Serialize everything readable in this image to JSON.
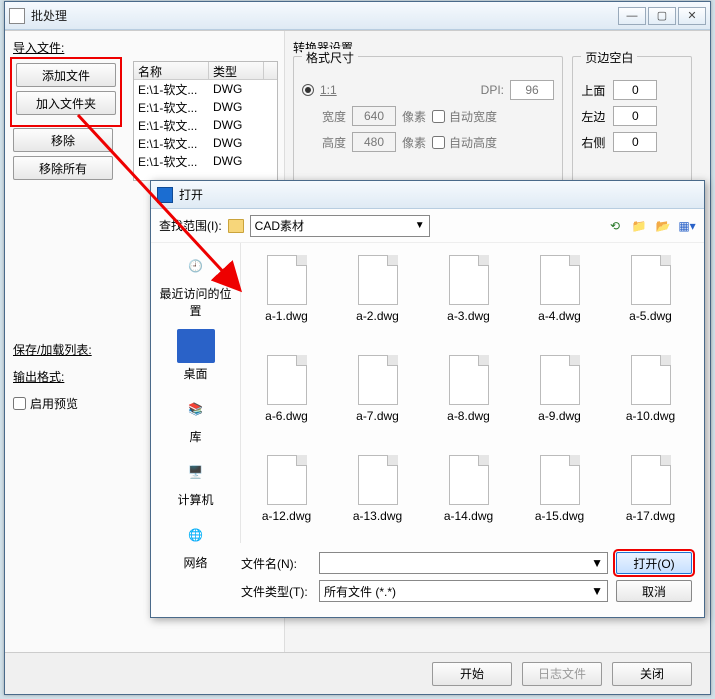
{
  "main_window": {
    "title": "批处理",
    "import_label": "导入文件:",
    "buttons": {
      "add_file": "添加文件",
      "add_folder": "加入文件夹",
      "remove": "移除",
      "remove_all": "移除所有"
    },
    "file_list": {
      "cols": {
        "name": "名称",
        "type": "类型"
      },
      "rows": [
        {
          "name": "E:\\1-软文...",
          "type": "DWG"
        },
        {
          "name": "E:\\1-软文...",
          "type": "DWG"
        },
        {
          "name": "E:\\1-软文...",
          "type": "DWG"
        },
        {
          "name": "E:\\1-软文...",
          "type": "DWG"
        },
        {
          "name": "E:\\1-软文...",
          "type": "DWG"
        }
      ]
    },
    "save_list_label": "保存/加载列表:",
    "output_format_label": "输出格式:",
    "enable_preview_label": "启用预览"
  },
  "converter": {
    "group_label": "转换器设置",
    "size_group_label": "格式尺寸",
    "ratio_label": "1:1",
    "dpi_label": "DPI:",
    "dpi_value": "96",
    "width_label": "宽度",
    "width_value": "640",
    "width_unit": "像素",
    "auto_width_label": "自动宽度",
    "height_label": "高度",
    "height_value": "480",
    "height_unit": "像素",
    "auto_height_label": "自动高度",
    "margin_group_label": "页边空白",
    "top_label": "上面",
    "top_value": "0",
    "left_label": "左边",
    "left_value": "0",
    "right_label": "右侧",
    "right_value": "0"
  },
  "bottom": {
    "start": "开始",
    "log": "日志文件",
    "close": "关闭"
  },
  "open_dialog": {
    "title": "打开",
    "range_label": "查找范围(I):",
    "folder_name": "CAD素材",
    "places": {
      "recent": "最近访问的位置",
      "desktop": "桌面",
      "libraries": "库",
      "computer": "计算机",
      "network": "网络"
    },
    "files": [
      "a-1.dwg",
      "a-2.dwg",
      "a-3.dwg",
      "a-4.dwg",
      "a-5.dwg",
      "a-6.dwg",
      "a-7.dwg",
      "a-8.dwg",
      "a-9.dwg",
      "a-10.dwg",
      "a-12.dwg",
      "a-13.dwg",
      "a-14.dwg",
      "a-15.dwg",
      "a-17.dwg"
    ],
    "filename_label": "文件名(N):",
    "filename_value": "",
    "filetype_label": "文件类型(T):",
    "filetype_value": "所有文件 (*.*)",
    "open_btn": "打开(O)",
    "cancel_btn": "取消"
  }
}
